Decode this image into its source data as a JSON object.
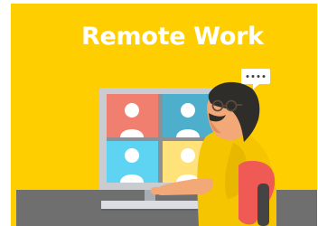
{
  "banner": {
    "title": "Remote Work",
    "colors": {
      "background": "#FFCE00",
      "monitor": "#C9CCD1",
      "screen_tile_top_left": "#F07F6F",
      "screen_tile_top_right": "#4DAFCB",
      "screen_tile_bottom_left": "#5FD4F2",
      "screen_tile_bottom_right": "#FFE27A",
      "desk": "#6F6F6F",
      "hair": "#2F2D2A",
      "skin": "#F2A977",
      "shirt": "#F4C500",
      "chair": "#F05A55"
    },
    "icons": {
      "speech": "speech-bubble-icon",
      "participant": "user-silhouette-icon"
    }
  }
}
